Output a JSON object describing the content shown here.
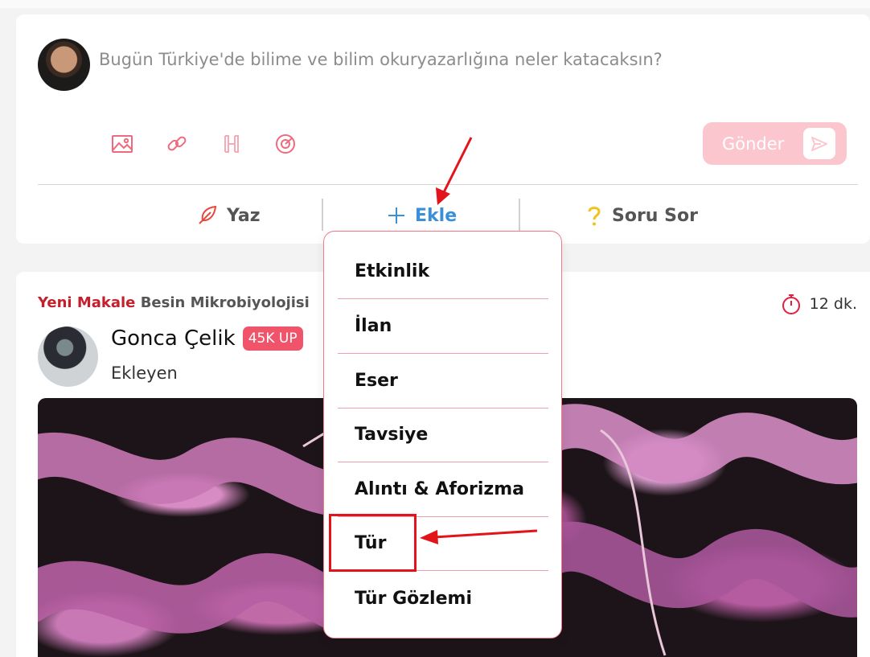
{
  "composer": {
    "prompt_placeholder": "Bugün Türkiye'de bilime ve bilim okuryazarlığına neler katacaksın?",
    "tools": [
      "image-icon",
      "link-icon",
      "heading-icon",
      "target-icon"
    ],
    "send_label": "Gönder",
    "actions": [
      {
        "label": "Yaz",
        "icon": "feather-icon"
      },
      {
        "label": "Ekle",
        "icon": "plus-icon"
      },
      {
        "label": "Soru Sor",
        "icon": "question-icon"
      }
    ]
  },
  "post": {
    "tag": "Yeni Makale",
    "topic": "Besin Mikrobiyolojisi",
    "read_time": "12 dk.",
    "author": "Gonca Çelik",
    "badge": "45K UP",
    "role": "Ekleyen"
  },
  "dropdown": {
    "items": [
      "Etkinlik",
      "İlan",
      "Eser",
      "Tavsiye",
      "Alıntı & Aforizma",
      "Tür",
      "Tür Gözlemi"
    ]
  },
  "colors": {
    "brand": "#e41e3f",
    "send_disabled": "#fbc6ce",
    "ekle_blue": "#3a8fd9",
    "annotation_red": "#e3131b"
  }
}
